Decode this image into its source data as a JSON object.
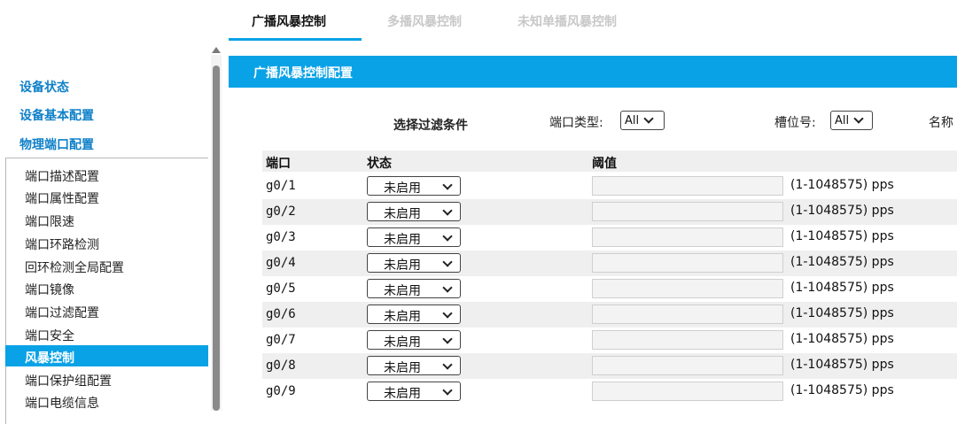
{
  "tabs": [
    {
      "label": "广播风暴控制",
      "active": true
    },
    {
      "label": "多播风暴控制",
      "active": false
    },
    {
      "label": "未知单播风暴控制",
      "active": false
    }
  ],
  "sidebar": {
    "top_links": [
      "设备状态",
      "设备基本配置",
      "物理端口配置"
    ],
    "items": [
      {
        "label": "端口描述配置"
      },
      {
        "label": "端口属性配置"
      },
      {
        "label": "端口限速"
      },
      {
        "label": "端口环路检测"
      },
      {
        "label": "回环检测全局配置"
      },
      {
        "label": "端口镜像"
      },
      {
        "label": "端口过滤配置"
      },
      {
        "label": "端口安全"
      },
      {
        "label": "风暴控制",
        "active": true
      },
      {
        "label": "端口保护组配置"
      },
      {
        "label": "端口电缆信息"
      }
    ]
  },
  "section": {
    "title": "广播风暴控制配置"
  },
  "filter": {
    "title": "选择过滤条件",
    "port_type_label": "端口类型:",
    "port_type_value": "All",
    "slot_label": "槽位号:",
    "slot_value": "All",
    "name_label": "名称"
  },
  "table": {
    "headers": {
      "port": "端口",
      "state": "状态",
      "threshold": "阈值"
    },
    "rows": [
      {
        "port": "g0/1",
        "state": "未启用",
        "threshold": "",
        "range": "(1-1048575) pps"
      },
      {
        "port": "g0/2",
        "state": "未启用",
        "threshold": "",
        "range": "(1-1048575) pps"
      },
      {
        "port": "g0/3",
        "state": "未启用",
        "threshold": "",
        "range": "(1-1048575) pps"
      },
      {
        "port": "g0/4",
        "state": "未启用",
        "threshold": "",
        "range": "(1-1048575) pps"
      },
      {
        "port": "g0/5",
        "state": "未启用",
        "threshold": "",
        "range": "(1-1048575) pps"
      },
      {
        "port": "g0/6",
        "state": "未启用",
        "threshold": "",
        "range": "(1-1048575) pps"
      },
      {
        "port": "g0/7",
        "state": "未启用",
        "threshold": "",
        "range": "(1-1048575) pps"
      },
      {
        "port": "g0/8",
        "state": "未启用",
        "threshold": "",
        "range": "(1-1048575) pps"
      },
      {
        "port": "g0/9",
        "state": "未启用",
        "threshold": "",
        "range": "(1-1048575) pps"
      }
    ]
  },
  "colors": {
    "accent": "#0aa2e6",
    "link": "#0f80c8",
    "row_alt": "#efefef"
  }
}
